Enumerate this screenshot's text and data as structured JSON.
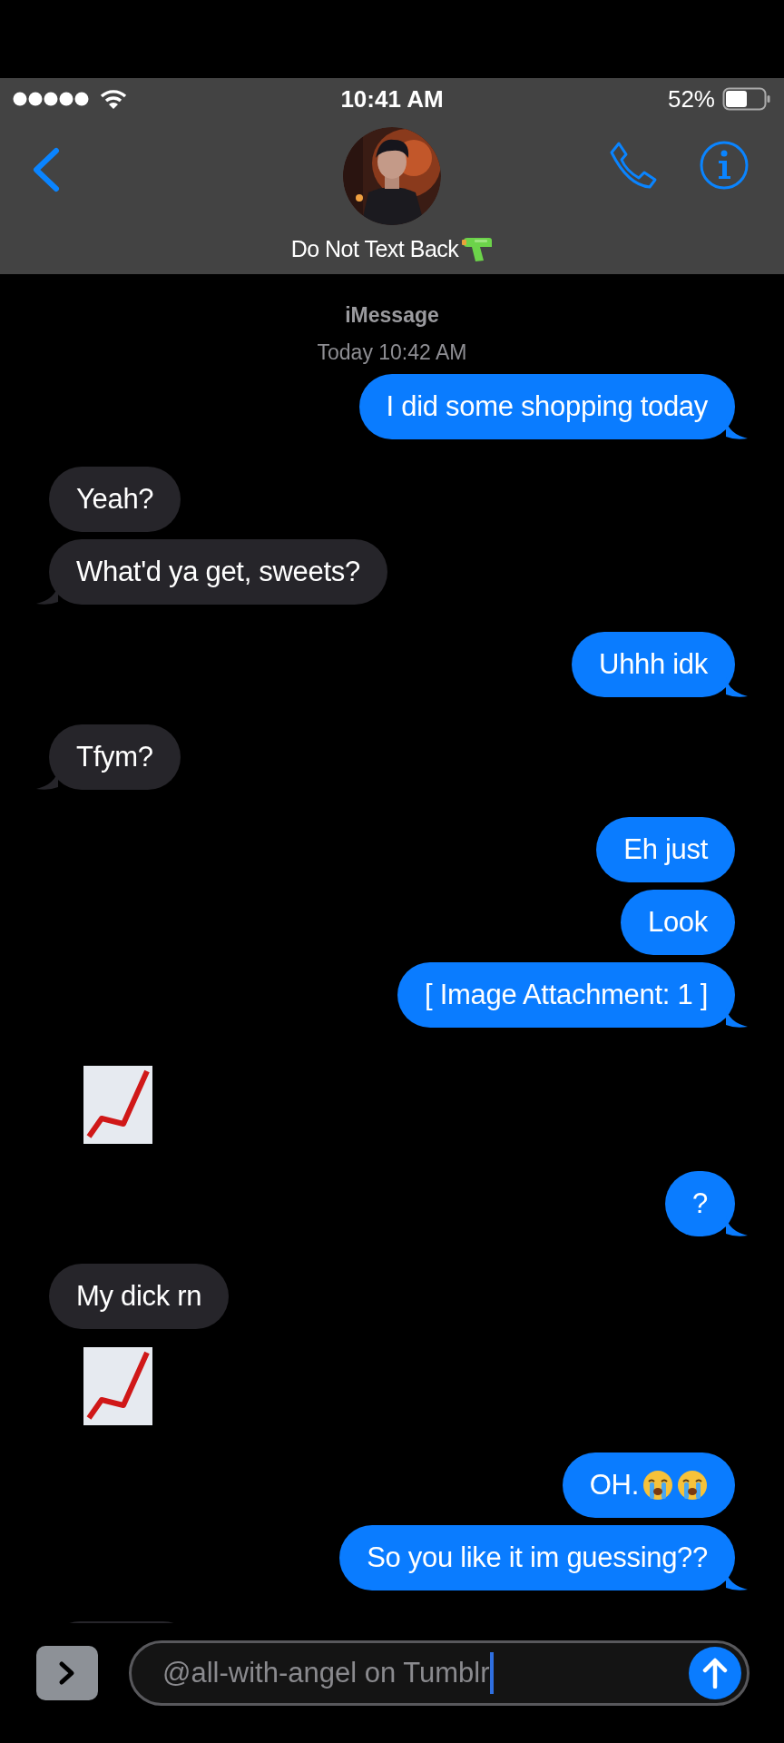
{
  "status_bar": {
    "time": "10:41 AM",
    "battery": "52%"
  },
  "header": {
    "contact_name": "Do Not Text Back"
  },
  "thread": {
    "service": "iMessage",
    "timestamp": "Today 10:42 AM",
    "groups": [
      {
        "outgoing": true,
        "items": [
          {
            "kind": "text",
            "text": "I did some shopping today"
          }
        ]
      },
      {
        "outgoing": false,
        "items": [
          {
            "kind": "text",
            "text": "Yeah?"
          },
          {
            "kind": "text",
            "text": "What'd ya get, sweets?"
          }
        ]
      },
      {
        "outgoing": true,
        "items": [
          {
            "kind": "text",
            "text": "Uhhh idk"
          }
        ]
      },
      {
        "outgoing": false,
        "items": [
          {
            "kind": "text",
            "text": "Tfym?"
          }
        ]
      },
      {
        "outgoing": true,
        "items": [
          {
            "kind": "text",
            "text": "Eh just"
          },
          {
            "kind": "text",
            "text": "Look"
          },
          {
            "kind": "text",
            "text": "[ Image Attachment: 1 ]"
          }
        ]
      },
      {
        "outgoing": false,
        "items": [
          {
            "kind": "chart_emoji"
          }
        ]
      },
      {
        "outgoing": true,
        "items": [
          {
            "kind": "text",
            "text": "?"
          }
        ]
      },
      {
        "outgoing": false,
        "items": [
          {
            "kind": "text",
            "text": "My dick rn"
          },
          {
            "kind": "chart_emoji"
          }
        ]
      },
      {
        "outgoing": true,
        "items": [
          {
            "kind": "text_crying",
            "text": "OH."
          },
          {
            "kind": "text",
            "text": "So you like it im guessing??"
          }
        ]
      },
      {
        "outgoing": false,
        "items": [
          {
            "kind": "partial"
          }
        ]
      }
    ]
  },
  "composer": {
    "value": "@all-with-angel on Tumblr"
  }
}
